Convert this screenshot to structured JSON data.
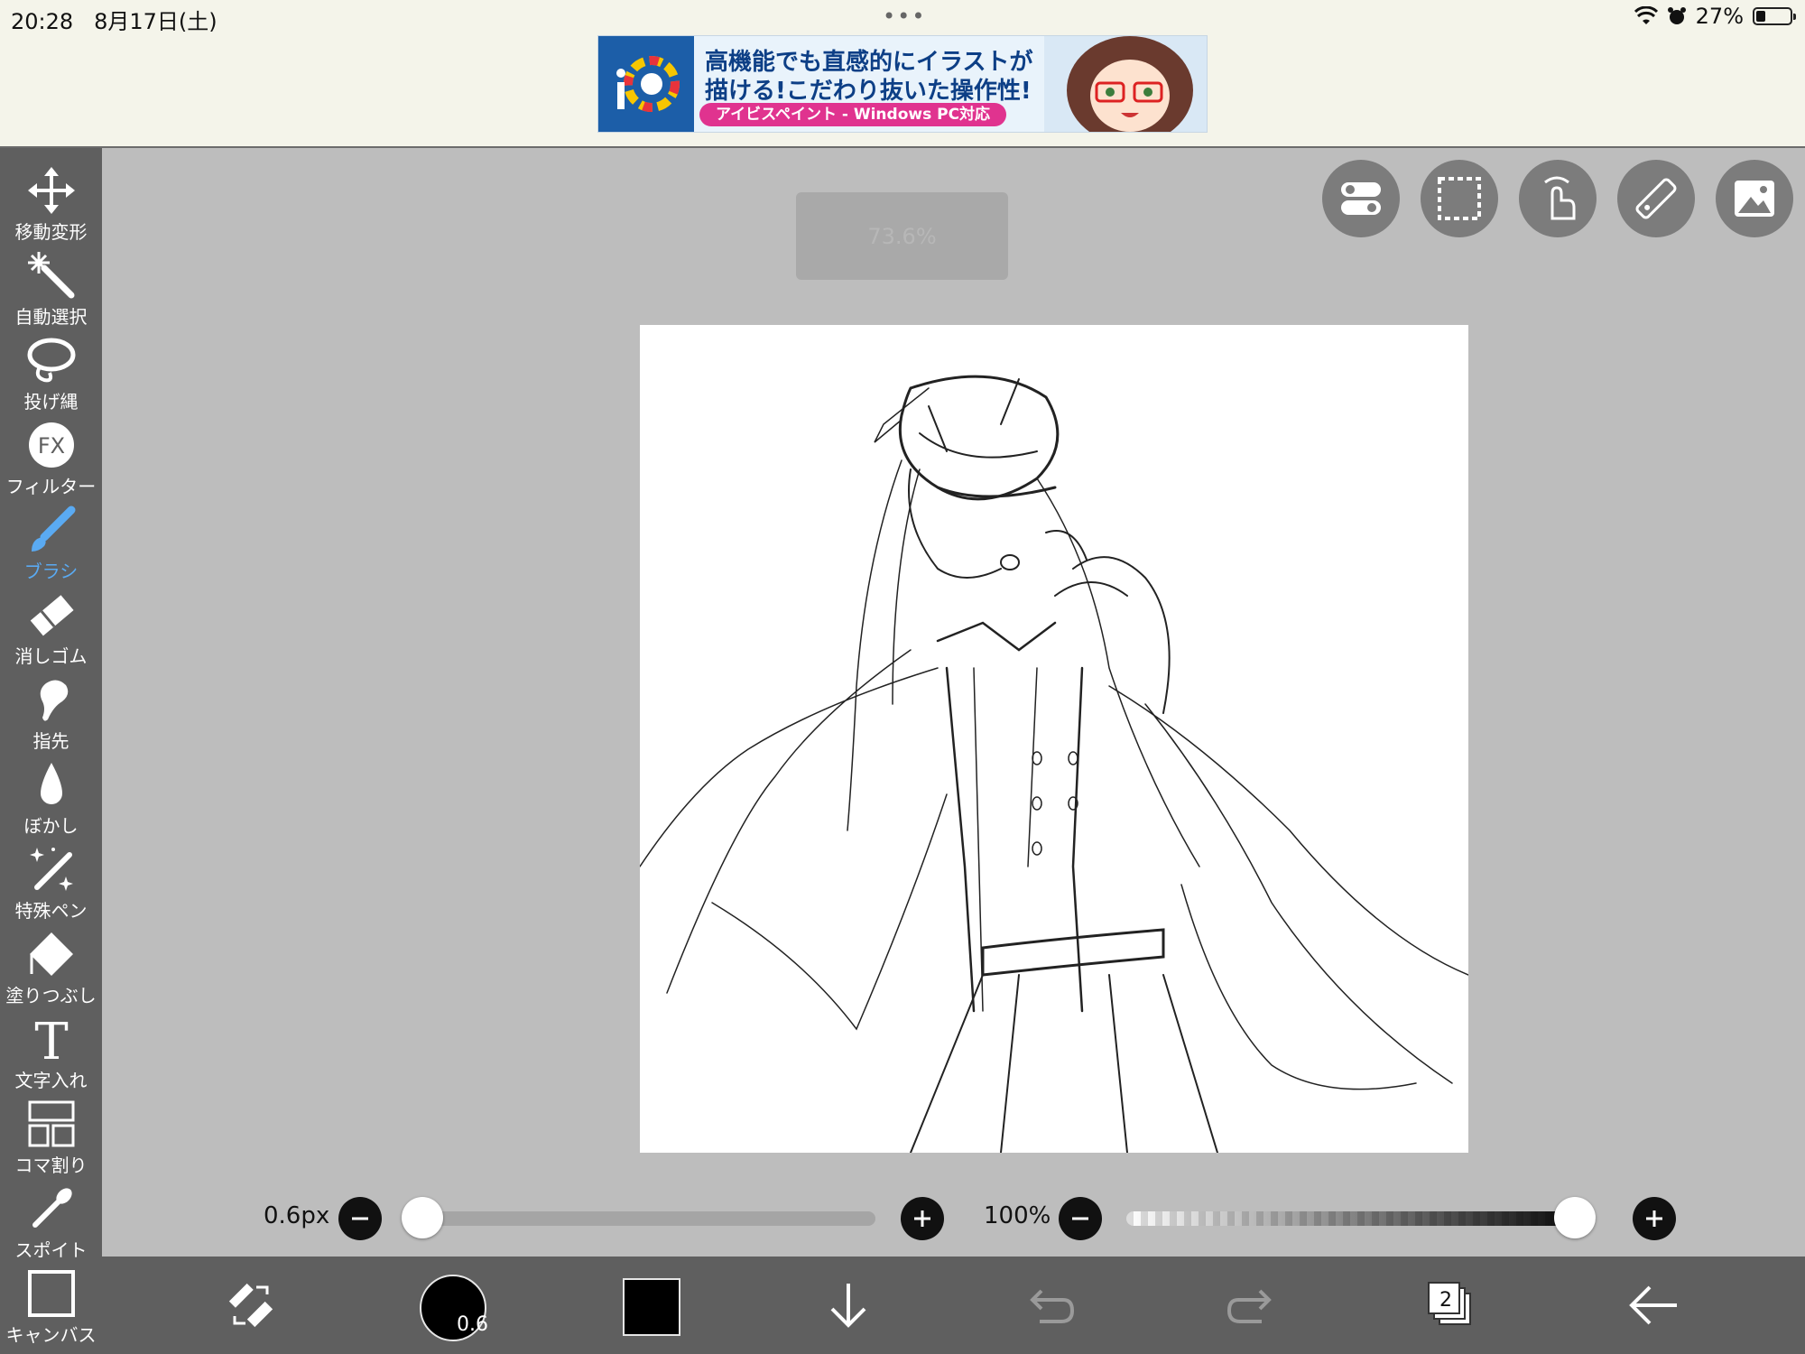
{
  "status": {
    "time": "20:28",
    "date": "8月17日(土)",
    "dots": "•••",
    "battery": "27%",
    "battery_level": 0.27
  },
  "ad": {
    "logo": "iP",
    "line1": "高機能でも直感的にイラストが",
    "line2": "描ける!こだわり抜いた操作性!",
    "pill": "アイビスペイント - Windows PC対応"
  },
  "tools": [
    {
      "label": "移動変形",
      "icon": "move-icon"
    },
    {
      "label": "自動選択",
      "icon": "magic-wand-icon"
    },
    {
      "label": "投げ縄",
      "icon": "lasso-icon"
    },
    {
      "label": "フィルター",
      "icon": "fx-icon"
    },
    {
      "label": "ブラシ",
      "icon": "brush-icon"
    },
    {
      "label": "消しゴム",
      "icon": "eraser-icon"
    },
    {
      "label": "指先",
      "icon": "smudge-icon"
    },
    {
      "label": "ぼかし",
      "icon": "blur-icon"
    },
    {
      "label": "特殊ペン",
      "icon": "special-pen-icon"
    },
    {
      "label": "塗りつぶし",
      "icon": "fill-icon"
    },
    {
      "label": "文字入れ",
      "icon": "text-icon"
    },
    {
      "label": "コマ割り",
      "icon": "frame-divider-icon"
    },
    {
      "label": "スポイト",
      "icon": "eyedropper-icon"
    },
    {
      "label": "キャンバス",
      "icon": "canvas-icon"
    }
  ],
  "active_tool": "ブラシ",
  "zoom_toast": "73.6%",
  "brush_size": {
    "value": "0.6px",
    "fraction": 0.0
  },
  "opacity": {
    "value": "100%",
    "fraction": 1.0
  },
  "brush_indicator": "0.6",
  "layers_count": "2",
  "colors": {
    "accent": "#5aaaf2",
    "toolbar": "#5f5f5f",
    "canvas_bg": "#bdbdbd",
    "current_color": "#000000"
  }
}
